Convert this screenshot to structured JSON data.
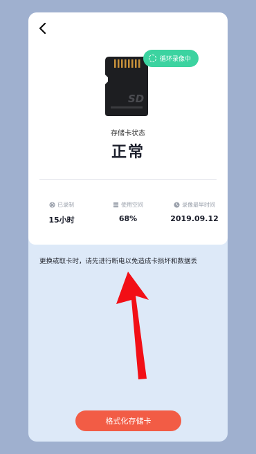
{
  "header": {
    "back_icon": "chevron-left-icon"
  },
  "card": {
    "sd_label": "SD",
    "badge": "循环录像中",
    "status_label": "存储卡状态",
    "status_value": "正常"
  },
  "stats": [
    {
      "icon": "record-reel-icon",
      "label": "已录制",
      "value": "15小时"
    },
    {
      "icon": "storage-icon",
      "label": "使用空间",
      "value": "68%"
    },
    {
      "icon": "clock-icon",
      "label": "录像最早时间",
      "value": "2019.09.12"
    }
  ],
  "notice": "更换或取卡时，请先进行断电以免造成卡损坏和数据丢",
  "format_button": "格式化存储卡",
  "colors": {
    "backdrop": "#9fb0cf",
    "panel": "#dde9f8",
    "badge": "#3cd3a0",
    "primary_button": "#f25c45",
    "annotation_arrow": "#f20f16"
  }
}
